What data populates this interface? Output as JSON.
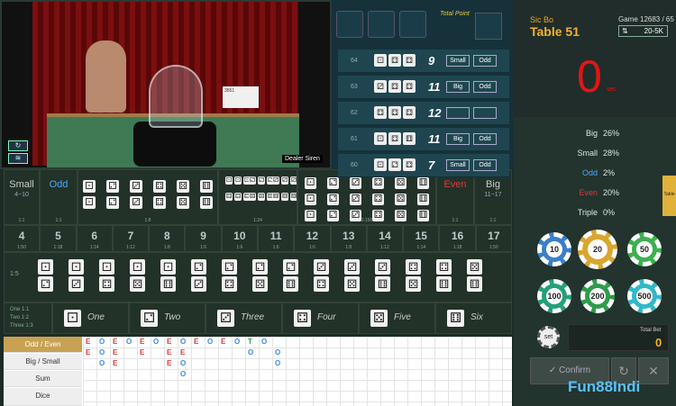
{
  "video": {
    "dealer_label": "Dealer Siren",
    "badge": "3551"
  },
  "result_panel": {
    "title": "Total Point",
    "rows": [
      {
        "round": "64",
        "dice": [
          "⚀",
          "⚃",
          "⚃"
        ],
        "total": "9",
        "tags": [
          "Small",
          "Odd"
        ]
      },
      {
        "round": "63",
        "dice": [
          "⚂",
          "⚃",
          "⚃"
        ],
        "total": "11",
        "tags": [
          "Big",
          "Odd"
        ]
      },
      {
        "round": "62",
        "dice": [
          "⚃",
          "⚃",
          "⚃"
        ],
        "total": "12",
        "tags": [
          "",
          ""
        ]
      },
      {
        "round": "61",
        "dice": [
          "⚀",
          "⚃",
          "⚅"
        ],
        "total": "11",
        "tags": [
          "Big",
          "Odd"
        ]
      },
      {
        "round": "60",
        "dice": [
          "⚀",
          "⚁",
          "⚃"
        ],
        "total": "7",
        "tags": [
          "Small",
          "Odd"
        ]
      }
    ]
  },
  "header": {
    "game_type": "Sic Bo",
    "table": "Table 51",
    "game_id": "Game 12683 / 65",
    "limit": "20-5K"
  },
  "timer": {
    "value": "0",
    "unit": "sec"
  },
  "stats": [
    {
      "label": "Big",
      "value": "26%",
      "color": "#dfe6e2"
    },
    {
      "label": "Small",
      "value": "28%",
      "color": "#dfe6e2"
    },
    {
      "label": "Odd",
      "value": "2%",
      "color": "#4aa8ff"
    },
    {
      "label": "Even",
      "value": "20%",
      "color": "#e03a3a"
    },
    {
      "label": "Triple",
      "value": "0%",
      "color": "#dfe6e2"
    }
  ],
  "chips": [
    {
      "value": "10",
      "color": "#3a7fc9"
    },
    {
      "value": "20",
      "color": "#d9a630"
    },
    {
      "value": "50",
      "color": "#3cb04f"
    },
    {
      "value": "100",
      "color": "#23a07a"
    },
    {
      "value": "200",
      "color": "#2f9c4a"
    },
    {
      "value": "500",
      "color": "#2fb9c8"
    }
  ],
  "set_label": "set",
  "total_bet": {
    "label": "Total Bet",
    "value": "0"
  },
  "actions": {
    "confirm": "Confirm"
  },
  "brand": "Fun88Indi",
  "side_tab": "Table",
  "board": {
    "small": {
      "label": "Small",
      "range": "4~10",
      "odds": "1:1"
    },
    "odd": {
      "label": "Odd",
      "odds": "1:1"
    },
    "even": {
      "label": "Even",
      "odds": "1:1"
    },
    "big": {
      "label": "Big",
      "range": "11~17",
      "odds": "1:1"
    },
    "doubles_odds": "1:8",
    "any_triple_odds": "1:24",
    "triples_odds": "1:150",
    "totals": [
      {
        "n": "4",
        "o": "1:50"
      },
      {
        "n": "5",
        "o": "1:18"
      },
      {
        "n": "6",
        "o": "1:14"
      },
      {
        "n": "7",
        "o": "1:12"
      },
      {
        "n": "8",
        "o": "1:8"
      },
      {
        "n": "9",
        "o": "1:6"
      },
      {
        "n": "10",
        "o": "1:6"
      },
      {
        "n": "11",
        "o": "1:6"
      },
      {
        "n": "12",
        "o": "1:6"
      },
      {
        "n": "13",
        "o": "1:8"
      },
      {
        "n": "14",
        "o": "1:12"
      },
      {
        "n": "15",
        "o": "1:14"
      },
      {
        "n": "16",
        "o": "1:18"
      },
      {
        "n": "17",
        "o": "1:50"
      }
    ],
    "combo_odds": "1:5",
    "singles": [
      {
        "label": "One",
        "die": "⚀"
      },
      {
        "label": "Two",
        "die": "⚁"
      },
      {
        "label": "Three",
        "die": "⚂"
      },
      {
        "label": "Four",
        "die": "⚃"
      },
      {
        "label": "Five",
        "die": "⚄"
      },
      {
        "label": "Six",
        "die": "⚅"
      }
    ],
    "single_odds": [
      "One 1:1",
      "Two 1:2",
      "Three 1:3"
    ]
  },
  "roadmap": {
    "tabs": [
      "Odd / Even",
      "Big / Small",
      "Sum",
      "Dice"
    ]
  }
}
